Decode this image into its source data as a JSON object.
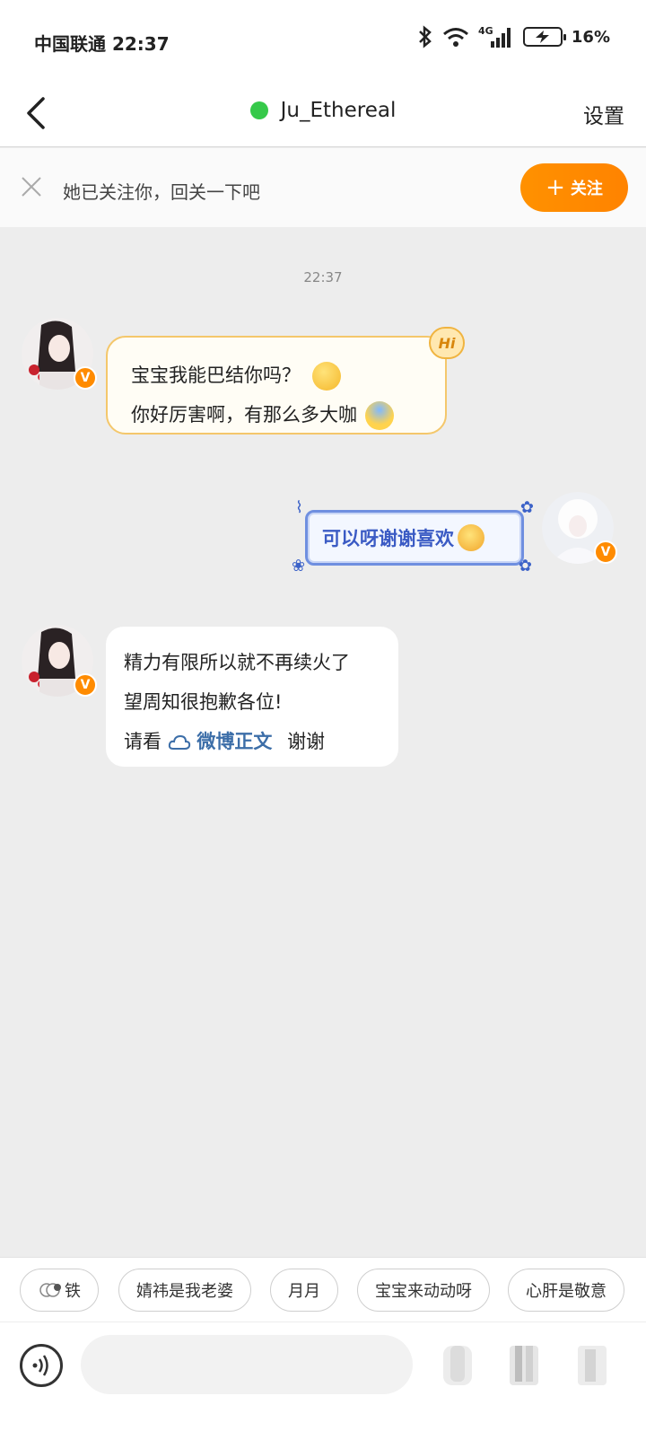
{
  "status": {
    "carrier": "中国联通 22:37",
    "network": "4G",
    "battery": "16%"
  },
  "nav": {
    "name": "Ju_Ethereal",
    "settings": "设置"
  },
  "follow": {
    "text": "她已关注你，回关一下吧",
    "button": "关注"
  },
  "chat": {
    "timestamp": "22:37",
    "hi_tag": "Hi",
    "msg1": {
      "line1": "宝宝我能巴结你吗？",
      "line2": "你好厉害啊，有那么多大咖"
    },
    "msg2": {
      "text": "可以呀谢谢喜欢"
    },
    "msg3": {
      "line1": "精力有限所以就不再续火了",
      "line2": "望周知很抱歉各位!",
      "line3_prefix": "请看",
      "link": "微博正文",
      "line3_suffix": "谢谢"
    }
  },
  "quick_replies": [
    "铁",
    "婧祎是我老婆",
    "月月",
    "宝宝来动动呀",
    "心肝是敬意"
  ],
  "input": {
    "placeholder": ""
  },
  "colors": {
    "accent": "#ff8b00",
    "online": "#36c94a",
    "link": "#3c6ea8",
    "my_bubble": "#6f8fe0"
  },
  "icons": [
    "bluetooth-icon",
    "wifi-icon",
    "signal-icon",
    "battery-icon",
    "back-icon",
    "close-icon",
    "voice-icon",
    "emoji-icon",
    "image-icon",
    "plus-icon"
  ]
}
